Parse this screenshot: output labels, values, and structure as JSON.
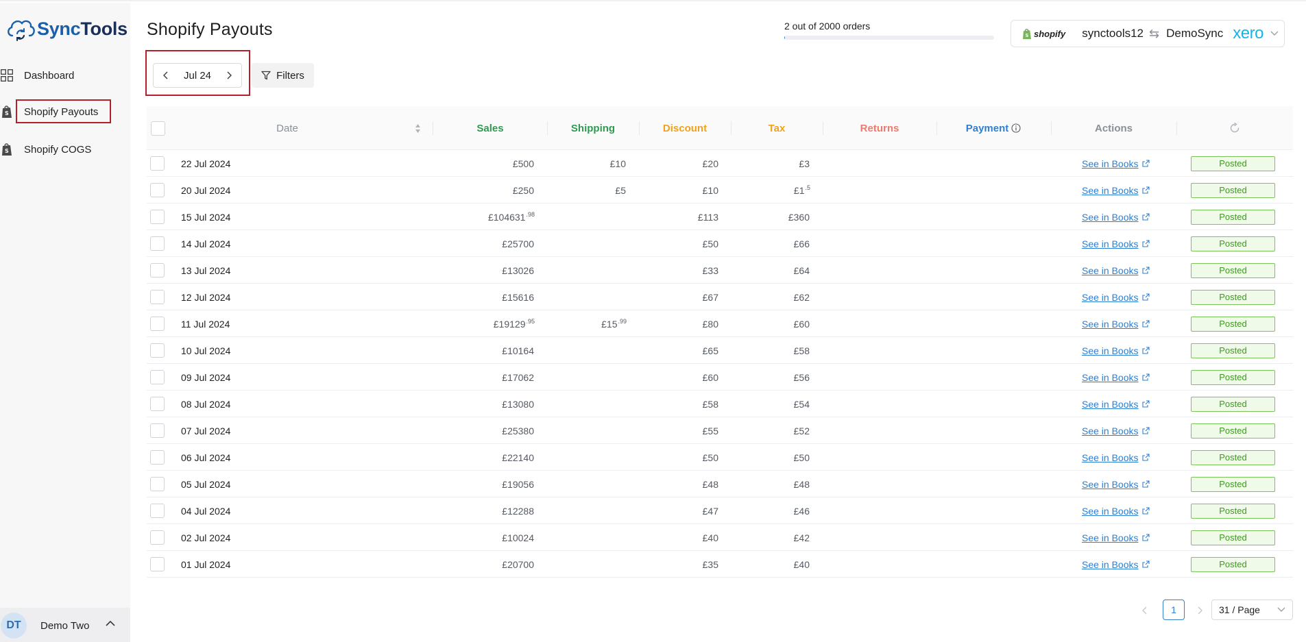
{
  "app": {
    "logo_part1": "Sync",
    "logo_part2": "Tools"
  },
  "sidebar": {
    "items": [
      {
        "label": "Dashboard",
        "icon": "grid-icon"
      },
      {
        "label": "Shopify Payouts",
        "icon": "shopify-bag-icon",
        "active": true
      },
      {
        "label": "Shopify COGS",
        "icon": "shopify-bag-icon"
      }
    ],
    "user": {
      "initials": "DT",
      "name": "Demo Two"
    }
  },
  "header": {
    "title": "Shopify Payouts",
    "progress_text": "2 out of 2000 orders",
    "progress_fraction": 0.001,
    "connection": {
      "source_brand": "shopify",
      "source_account": "synctools12",
      "target_org": "DemoSync",
      "target_brand": "xero"
    }
  },
  "toolbar": {
    "month": "Jul 24",
    "filters_label": "Filters"
  },
  "table": {
    "columns": {
      "date": "Date",
      "sales": "Sales",
      "shipping": "Shipping",
      "discount": "Discount",
      "tax": "Tax",
      "returns": "Returns",
      "payment": "Payment",
      "actions": "Actions"
    },
    "colors": {
      "sales": "#2e9a52",
      "shipping": "#2e9a52",
      "discount": "#f0a21a",
      "tax": "#f0a21a",
      "returns": "#f07a6e",
      "payment": "#2f80d1",
      "actions": "#8a8f98"
    },
    "link_label": "See in Books",
    "status_label": "Posted",
    "rows": [
      {
        "date": "22 Jul 2024",
        "sales": "£500",
        "sales_dec": "",
        "shipping": "£10",
        "shipping_dec": "",
        "discount": "£20",
        "tax": "£3",
        "tax_dec": ""
      },
      {
        "date": "20 Jul 2024",
        "sales": "£250",
        "sales_dec": "",
        "shipping": "£5",
        "shipping_dec": "",
        "discount": "£10",
        "tax": "£1",
        "tax_dec": ".5"
      },
      {
        "date": "15 Jul 2024",
        "sales": "£104631",
        "sales_dec": ".98",
        "shipping": "",
        "shipping_dec": "",
        "discount": "£113",
        "tax": "£360",
        "tax_dec": ""
      },
      {
        "date": "14 Jul 2024",
        "sales": "£25700",
        "sales_dec": "",
        "shipping": "",
        "shipping_dec": "",
        "discount": "£50",
        "tax": "£66",
        "tax_dec": ""
      },
      {
        "date": "13 Jul 2024",
        "sales": "£13026",
        "sales_dec": "",
        "shipping": "",
        "shipping_dec": "",
        "discount": "£33",
        "tax": "£64",
        "tax_dec": ""
      },
      {
        "date": "12 Jul 2024",
        "sales": "£15616",
        "sales_dec": "",
        "shipping": "",
        "shipping_dec": "",
        "discount": "£67",
        "tax": "£62",
        "tax_dec": ""
      },
      {
        "date": "11 Jul 2024",
        "sales": "£19129",
        "sales_dec": ".95",
        "shipping": "£15",
        "shipping_dec": ".99",
        "discount": "£80",
        "tax": "£60",
        "tax_dec": ""
      },
      {
        "date": "10 Jul 2024",
        "sales": "£10164",
        "sales_dec": "",
        "shipping": "",
        "shipping_dec": "",
        "discount": "£65",
        "tax": "£58",
        "tax_dec": ""
      },
      {
        "date": "09 Jul 2024",
        "sales": "£17062",
        "sales_dec": "",
        "shipping": "",
        "shipping_dec": "",
        "discount": "£60",
        "tax": "£56",
        "tax_dec": ""
      },
      {
        "date": "08 Jul 2024",
        "sales": "£13080",
        "sales_dec": "",
        "shipping": "",
        "shipping_dec": "",
        "discount": "£58",
        "tax": "£54",
        "tax_dec": ""
      },
      {
        "date": "07 Jul 2024",
        "sales": "£25380",
        "sales_dec": "",
        "shipping": "",
        "shipping_dec": "",
        "discount": "£55",
        "tax": "£52",
        "tax_dec": ""
      },
      {
        "date": "06 Jul 2024",
        "sales": "£22140",
        "sales_dec": "",
        "shipping": "",
        "shipping_dec": "",
        "discount": "£50",
        "tax": "£50",
        "tax_dec": ""
      },
      {
        "date": "05 Jul 2024",
        "sales": "£19056",
        "sales_dec": "",
        "shipping": "",
        "shipping_dec": "",
        "discount": "£48",
        "tax": "£48",
        "tax_dec": ""
      },
      {
        "date": "04 Jul 2024",
        "sales": "£12288",
        "sales_dec": "",
        "shipping": "",
        "shipping_dec": "",
        "discount": "£47",
        "tax": "£46",
        "tax_dec": ""
      },
      {
        "date": "02 Jul 2024",
        "sales": "£10024",
        "sales_dec": "",
        "shipping": "",
        "shipping_dec": "",
        "discount": "£40",
        "tax": "£42",
        "tax_dec": ""
      },
      {
        "date": "01 Jul 2024",
        "sales": "£20700",
        "sales_dec": "",
        "shipping": "",
        "shipping_dec": "",
        "discount": "£35",
        "tax": "£40",
        "tax_dec": ""
      }
    ]
  },
  "pagination": {
    "current_page": "1",
    "page_size": "31 / Page"
  }
}
